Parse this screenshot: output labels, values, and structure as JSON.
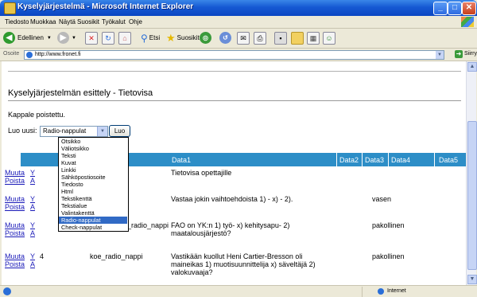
{
  "window": {
    "title": "Kyselyjärjestelmä - Microsoft Internet Explorer",
    "minimize": "_",
    "maximize": "□",
    "close": "✕"
  },
  "menu": [
    "Tiedosto",
    "Muokkaa",
    "Näytä",
    "Suosikit",
    "Työkalut",
    "Ohje"
  ],
  "toolbar": {
    "back_label": "Edellinen",
    "search_label": "Etsi",
    "favorites_label": "Suosikit"
  },
  "address": {
    "label": "Osoite",
    "url": "http://www.fronet.fi",
    "go_label": "Siirry"
  },
  "page": {
    "heading": "Kyselyjärjestelmän esittely - Tietovisa",
    "message": "Kappale poistettu.",
    "create_label": "Luo uusi:",
    "select_value": "Radio-nappulat",
    "create_button": "Luo"
  },
  "dropdown_options": [
    "Otsikko",
    "Väliotsikko",
    "Teksti",
    "Kuvat",
    "Linkki",
    "Sähköpostiosoite",
    "Tiedosto",
    "Html",
    "Tekstikenttä",
    "Tekstialue",
    "Valintakenttä",
    "Radio-nappulat",
    "Check-nappulat"
  ],
  "dropdown_selected_index": 11,
  "table": {
    "headers": [
      "Data1",
      "Data2",
      "Data3",
      "Data4",
      "Data5"
    ],
    "rows": [
      {
        "muuta": "Muuta",
        "poista": "Poista",
        "y": "Y",
        "a": "A",
        "num": "",
        "type": "",
        "type_tail": "o",
        "data1": "Tietovisa opettajille",
        "data4": ""
      },
      {
        "muuta": "Muuta",
        "poista": "Poista",
        "y": "Y",
        "a": "A",
        "num": "",
        "type": "",
        "type_tail": "",
        "data1": "Vastaa jokin vaihtoehdoista 1) - x) - 2).",
        "data4": "vasen"
      },
      {
        "muuta": "Muuta",
        "poista": "Poista",
        "y": "Y",
        "a": "A",
        "num": "",
        "type": "",
        "type_tail": "_radio_nappi",
        "data1": "FAO on YK:n 1) työ- x) kehitysapu- 2) maatalousjärjestö?",
        "data4": "pakollinen"
      },
      {
        "muuta": "Muuta",
        "poista": "Poista",
        "y": "Y",
        "a": "A",
        "num": "4",
        "type": "koe_radio_nappi",
        "type_tail": "",
        "data1": "Vastikään kuollut Heni Cartier-Bresson oli maineikas 1) muotisuunnittelija x) säveltäjä 2) valokuvaaja?",
        "data4": "pakollinen"
      }
    ]
  },
  "status": {
    "zone": "Internet"
  },
  "colors": {
    "table_header": "#2d8ec7",
    "link": "#1a1ab8",
    "selection": "#316ac5"
  }
}
